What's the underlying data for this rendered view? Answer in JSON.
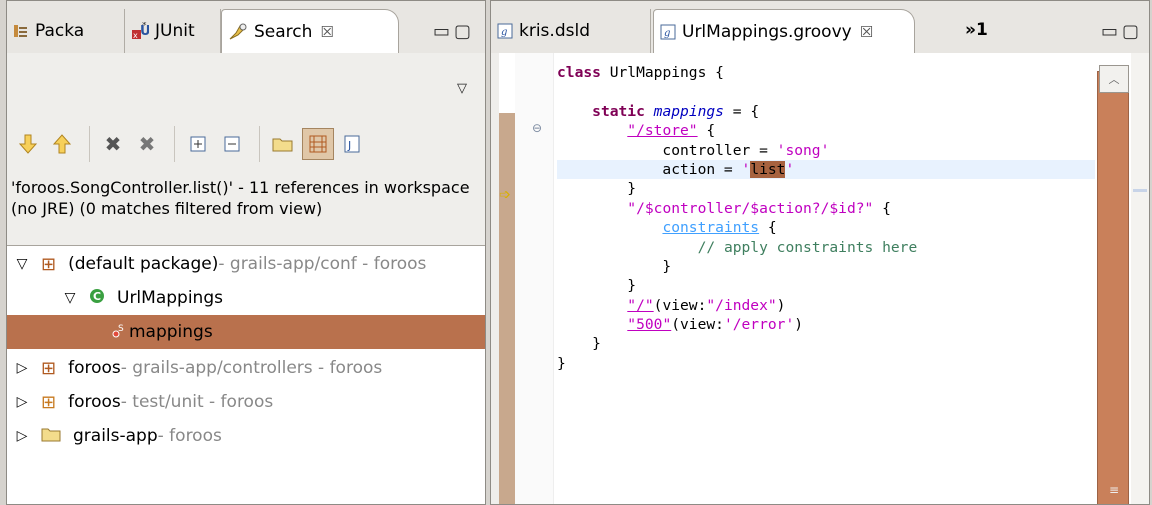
{
  "left_panel": {
    "tabs": [
      {
        "label": "Packa",
        "icon": "package-explorer-icon"
      },
      {
        "label": "JUnit",
        "icon": "junit-icon"
      },
      {
        "label": "Search",
        "icon": "search-icon",
        "close": "☒"
      }
    ],
    "status_text": "'foroos.SongController.list()' - 11 references in workspace (no JRE) (0 matches filtered from view)",
    "tree": [
      {
        "name": "(default package)",
        "detail": " - grails-app/conf - foroos",
        "expanded": true
      },
      {
        "name": "UrlMappings",
        "expanded": true
      },
      {
        "name": "mappings",
        "selected": true
      },
      {
        "name": "foroos",
        "detail": " - grails-app/controllers - foroos",
        "expanded": false
      },
      {
        "name": "foroos",
        "detail": " - test/unit - foroos",
        "expanded": false
      },
      {
        "name": "grails-app",
        "detail": " - foroos",
        "expanded": false
      }
    ]
  },
  "right_panel": {
    "tabs": [
      {
        "label": "kris.dsld"
      },
      {
        "label": "UrlMappings.groovy",
        "close": "☒"
      },
      {
        "label": "»1"
      }
    ],
    "code_lines": [
      [
        [
          "class UrlMappings {",
          "kw-class"
        ]
      ],
      [
        [
          "",
          ""
        ]
      ],
      [
        [
          "    ",
          ""
        ],
        [
          "static",
          "kw"
        ],
        [
          " ",
          ""
        ],
        [
          "mappings",
          "it"
        ],
        [
          " = {",
          ""
        ]
      ],
      [
        [
          "        ",
          ""
        ],
        [
          "\"/store\"",
          "strl"
        ],
        [
          " {",
          ""
        ]
      ],
      [
        [
          "            controller = ",
          ""
        ],
        [
          "'song'",
          "str"
        ]
      ],
      [
        [
          "            action = ",
          ""
        ],
        [
          "'",
          "str"
        ],
        [
          "list",
          "hl"
        ],
        [
          "'",
          "str"
        ]
      ],
      [
        [
          "        }",
          ""
        ]
      ],
      [
        [
          "        ",
          ""
        ],
        [
          "\"/$controller/$action?/$id?\"",
          "str"
        ],
        [
          " {",
          ""
        ]
      ],
      [
        [
          "            ",
          ""
        ],
        [
          "constraints",
          "cstr"
        ],
        [
          " {",
          ""
        ]
      ],
      [
        [
          "                ",
          ""
        ],
        [
          "// apply constraints here",
          "cm"
        ]
      ],
      [
        [
          "            }",
          ""
        ]
      ],
      [
        [
          "        }",
          ""
        ]
      ],
      [
        [
          "        ",
          ""
        ],
        [
          "\"/\"",
          "strl"
        ],
        [
          "(view:",
          ""
        ],
        [
          "\"/index\"",
          "str"
        ],
        [
          ")",
          ""
        ]
      ],
      [
        [
          "        ",
          ""
        ],
        [
          "\"500\"",
          "strl"
        ],
        [
          "(view:",
          ""
        ],
        [
          "'/error'",
          "str"
        ],
        [
          ")",
          ""
        ]
      ],
      [
        [
          "    }",
          ""
        ]
      ],
      [
        [
          "}",
          ""
        ]
      ]
    ]
  },
  "colors": {
    "selection": "#b9714d",
    "keyword": "#7f0055",
    "string": "#c000c0",
    "comment": "#3f7f5f"
  }
}
